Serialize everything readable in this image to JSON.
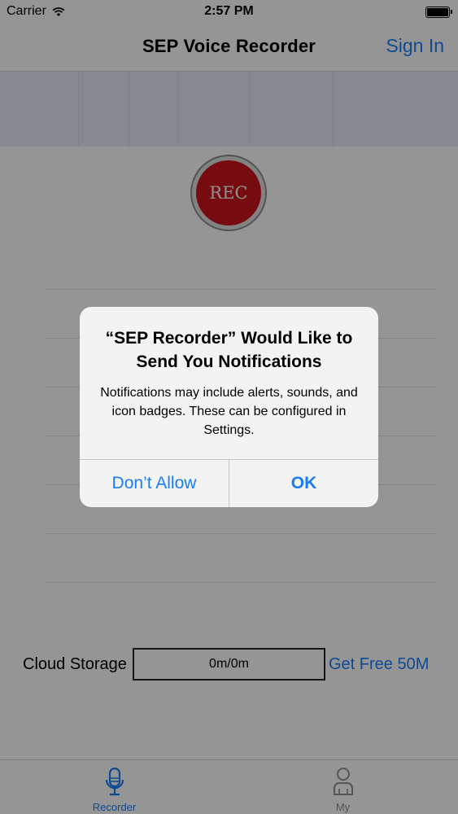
{
  "status_bar": {
    "carrier": "Carrier",
    "time": "2:57 PM"
  },
  "nav": {
    "title": "SEP Voice Recorder",
    "sign_in": "Sign In"
  },
  "rec_button": {
    "label": "REC"
  },
  "cloud": {
    "label": "Cloud Storage",
    "usage": "0m/0m",
    "get_free": "Get Free 50M"
  },
  "tabs": [
    {
      "label": "Recorder",
      "icon": "microphone-icon",
      "selected": true
    },
    {
      "label": "My",
      "icon": "person-icon",
      "selected": false
    }
  ],
  "alert": {
    "title": "“SEP Recorder” Would Like to Send You Notifications",
    "message": "Notifications may include alerts, sounds, and icon badges. These can be configured in Settings.",
    "buttons": {
      "dont_allow": "Don’t Allow",
      "ok": "OK"
    }
  },
  "colors": {
    "accent": "#1a7cf5",
    "rec_red": "#c5141c"
  }
}
